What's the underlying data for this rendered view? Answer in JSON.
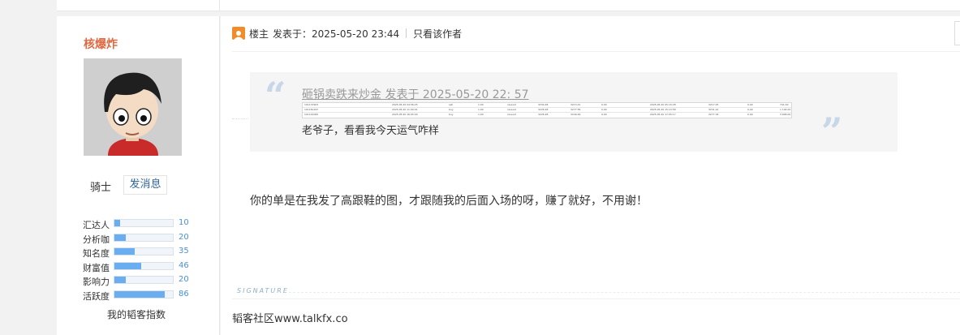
{
  "sidebar": {
    "username": "核爆炸",
    "rank": "骑士",
    "send_message": "发消息",
    "stats": [
      {
        "label": "汇达人",
        "value": "10",
        "level": 0.1
      },
      {
        "label": "分析咖",
        "value": "20",
        "level": 0.2
      },
      {
        "label": "知名度",
        "value": "35",
        "level": 0.35
      },
      {
        "label": "财富值",
        "value": "46",
        "level": 0.46
      },
      {
        "label": "影响力",
        "value": "20",
        "level": 0.2
      },
      {
        "label": "活跃度",
        "value": "86",
        "level": 0.86
      }
    ],
    "blog_index": "我的韬客指数"
  },
  "post": {
    "role": "楼主",
    "posted_at": "发表于：2025-05-20 23:44",
    "only_author": "只看该作者",
    "quote": {
      "link": "砸锅卖跌来炒金 发表于 2025-05-20 22: 57",
      "text": "老爷子，看看我今天运气咋样",
      "table_rows": [
        [
          "101172903",
          "2025.05.20 04:56:25",
          "sell",
          "1.00",
          "xauusd",
          "3234.48",
          "3213.41",
          "0.00",
          "2025.05.20 05:10:28",
          "3217.25",
          "0.00",
          "741.00"
        ],
        [
          "101181297",
          "2025.05.20 11:00:41",
          "buy",
          "1.00",
          "xauusd",
          "3226.26",
          "3277.56",
          "0.00",
          "2025.05.20 15:13:58",
          "3231.22",
          "0.00",
          "1 104.00"
        ],
        [
          "101191065",
          "2025.05.20 16:05:00",
          "buy",
          "1.00",
          "xauusd",
          "3226.28",
          "3249.49",
          "0.00",
          "2025.05.20 17:05:17",
          "3277.34",
          "0.00",
          "3 696.00"
        ]
      ]
    },
    "reply": "你的单是在我发了高跟鞋的图，才跟随我的后面入场的呀，赚了就好，不用谢！",
    "signature_label": "SIGNATURE",
    "signature": "韬客社区www.talkfx.co"
  },
  "colors": {
    "username": "#e06a43",
    "link": "#336699",
    "bar_fill": "#6aaef0",
    "quote_mark": "#c7d6e8"
  }
}
